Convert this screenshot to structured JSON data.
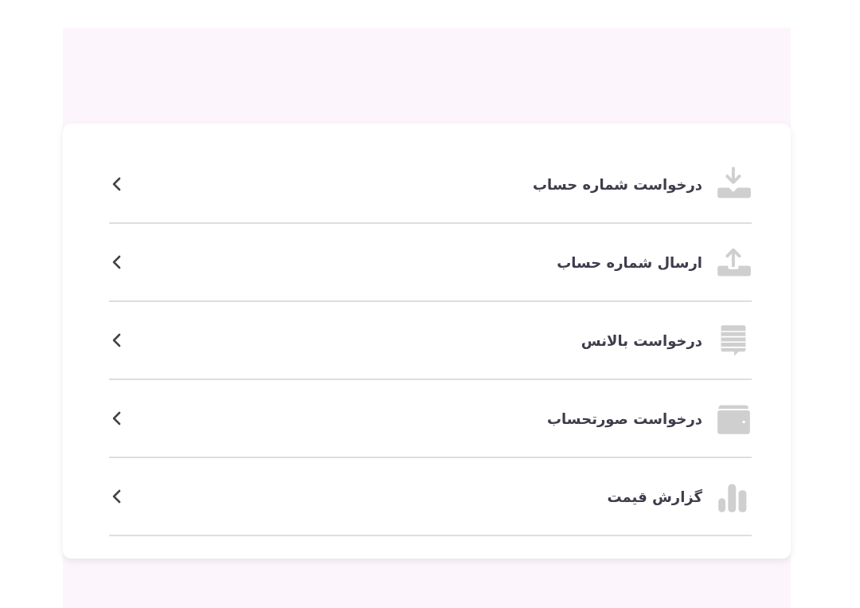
{
  "menu_items": [
    {
      "label": "درخواست شماره حساب"
    },
    {
      "label": "ارسال شماره حساب"
    },
    {
      "label": "درخواست بالانس"
    },
    {
      "label": "درخواست صورتحساب"
    },
    {
      "label": "گزارش قیمت"
    }
  ]
}
